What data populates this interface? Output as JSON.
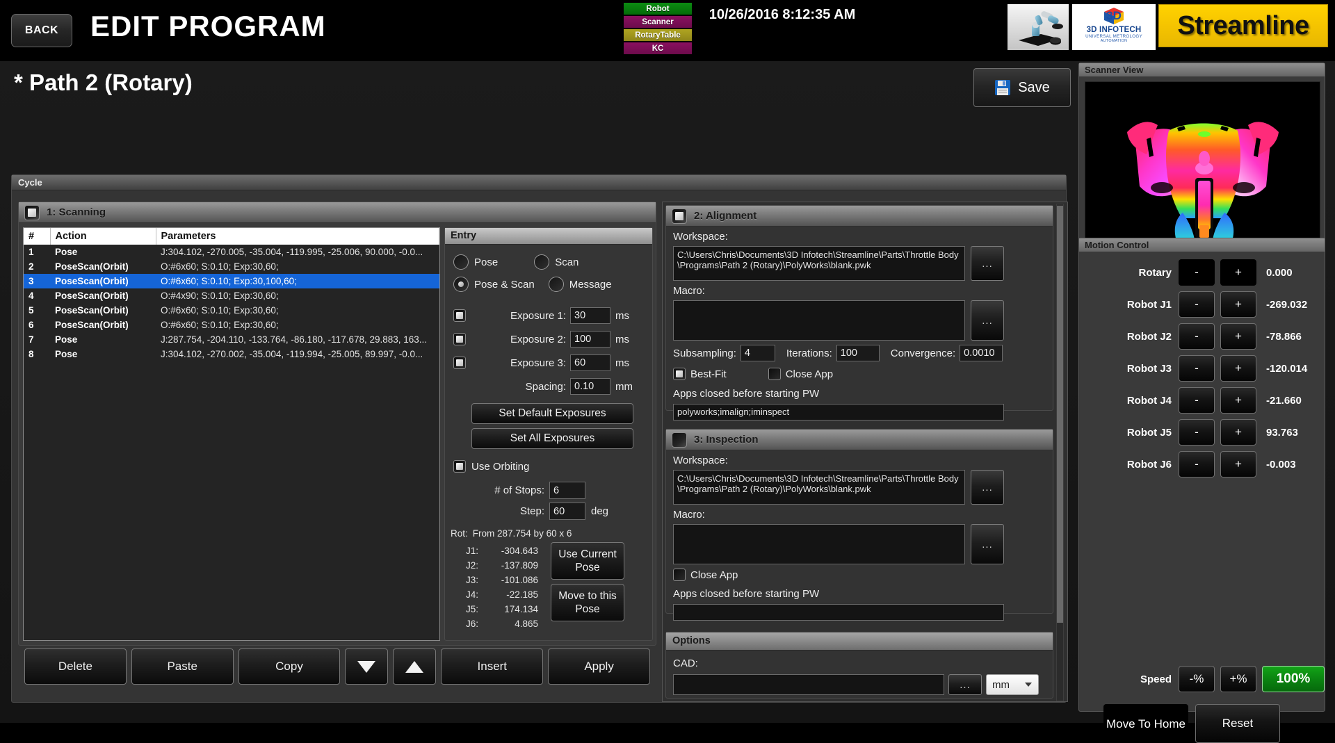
{
  "header": {
    "back_label": "BACK",
    "title": "EDIT PROGRAM",
    "datetime": "10/26/2016  8:12:35 AM",
    "status_chips": [
      {
        "label": "Robot",
        "color": "#0c8c12"
      },
      {
        "label": "Scanner",
        "color": "#8a1060"
      },
      {
        "label": "RotaryTable",
        "color": "#b0a521"
      },
      {
        "label": "KC",
        "color": "#8a1060"
      }
    ],
    "logo_3d_name": "3D INFOTECH",
    "logo_3d_sub": "UNIVERSAL METROLOGY",
    "logo_3d_sub2": "AUTOMATION",
    "logo_3d_cube": "3D",
    "logo_streamline": "Streamline"
  },
  "page": {
    "path_title": "* Path 2 (Rotary)",
    "save_label": "Save",
    "cycle_group_label": "Cycle"
  },
  "scanning": {
    "panel_title": "1: Scanning",
    "checked": true,
    "columns": [
      "#",
      "Action",
      "Parameters"
    ],
    "rows": [
      {
        "n": "1",
        "action": "Pose",
        "params": "J:304.102, -270.005, -35.004, -119.995, -25.006, 90.000, -0.0...",
        "selected": false
      },
      {
        "n": "2",
        "action": "PoseScan(Orbit)",
        "params": "O:#6x60; S:0.10; Exp:30,60;",
        "selected": false
      },
      {
        "n": "3",
        "action": "PoseScan(Orbit)",
        "params": "O:#6x60; S:0.10; Exp:30,100,60;",
        "selected": true
      },
      {
        "n": "4",
        "action": "PoseScan(Orbit)",
        "params": "O:#4x90; S:0.10; Exp:30,60;",
        "selected": false
      },
      {
        "n": "5",
        "action": "PoseScan(Orbit)",
        "params": "O:#6x60; S:0.10; Exp:30,60;",
        "selected": false
      },
      {
        "n": "6",
        "action": "PoseScan(Orbit)",
        "params": "O:#6x60; S:0.10; Exp:30,60;",
        "selected": false
      },
      {
        "n": "7",
        "action": "Pose",
        "params": "J:287.754, -204.110, -133.764, -86.180, -117.678, 29.883, 163...",
        "selected": false
      },
      {
        "n": "8",
        "action": "Pose",
        "params": "J:304.102, -270.002, -35.004, -119.994, -25.005, 89.997, -0.0...",
        "selected": false
      }
    ]
  },
  "action_buttons": [
    {
      "label": "Delete",
      "name": "delete-button"
    },
    {
      "label": "Paste",
      "name": "paste-button"
    },
    {
      "label": "Copy",
      "name": "copy-button"
    },
    {
      "label": "",
      "name": "move-down-button",
      "icon": "triangle-down-icon"
    },
    {
      "label": "",
      "name": "move-up-button",
      "icon": "triangle-up-icon"
    },
    {
      "label": "Insert",
      "name": "insert-button"
    },
    {
      "label": "Apply",
      "name": "apply-button"
    }
  ],
  "entry": {
    "panel_title": "Entry",
    "radios": [
      {
        "label": "Pose",
        "checked": false
      },
      {
        "label": "Scan",
        "checked": false
      },
      {
        "label": "Pose & Scan",
        "checked": true
      },
      {
        "label": "Message",
        "checked": false
      }
    ],
    "exposure1_label": "Exposure 1:",
    "exposure1_value": "30",
    "exposure1_checked": true,
    "exposure2_label": "Exposure 2:",
    "exposure2_value": "100",
    "exposure2_checked": true,
    "exposure3_label": "Exposure 3:",
    "exposure3_value": "60",
    "exposure3_checked": true,
    "ms_unit": "ms",
    "spacing_label": "Spacing:",
    "spacing_value": "0.10",
    "mm_unit": "mm",
    "set_default_exposures": "Set Default Exposures",
    "set_all_exposures": "Set All Exposures",
    "use_orbiting_label": "Use Orbiting",
    "use_orbiting_checked": true,
    "stops_label": "# of Stops:",
    "stops_value": "6",
    "step_label": "Step:",
    "step_value": "60",
    "deg_unit": "deg",
    "rot_label": "Rot:",
    "rot_value": "From 287.754 by 60 x 6",
    "joints": [
      {
        "label": "J1:",
        "value": "-304.643"
      },
      {
        "label": "J2:",
        "value": "-137.809"
      },
      {
        "label": "J3:",
        "value": "-101.086"
      },
      {
        "label": "J4:",
        "value": "-22.185"
      },
      {
        "label": "J5:",
        "value": "174.134"
      },
      {
        "label": "J6:",
        "value": "4.865"
      }
    ],
    "use_current_pose": "Use Current Pose",
    "move_to_this_pose": "Move to this Pose"
  },
  "alignment": {
    "panel_title": "2: Alignment",
    "checked": true,
    "workspace_label": "Workspace:",
    "workspace_value": "C:\\Users\\Chris\\Documents\\3D Infotech\\Streamline\\Parts\\Throttle Body\\Programs\\Path 2 (Rotary)\\PolyWorks\\blank.pwk",
    "macro_label": "Macro:",
    "macro_value": "",
    "browse_label": "...",
    "subsampling_label": "Subsampling:",
    "subsampling_value": "4",
    "iterations_label": "Iterations:",
    "iterations_value": "100",
    "convergence_label": "Convergence:",
    "convergence_value": "0.0010",
    "bestfit_label": "Best-Fit",
    "bestfit_checked": true,
    "closeapp_label": "Close App",
    "closeapp_checked": false,
    "apps_closed_label": "Apps closed before starting PW",
    "apps_closed_value": "polyworks;imalign;iminspect"
  },
  "inspection": {
    "panel_title": "3: Inspection",
    "checked": false,
    "workspace_label": "Workspace:",
    "workspace_value": "C:\\Users\\Chris\\Documents\\3D Infotech\\Streamline\\Parts\\Throttle Body\\Programs\\Path 2 (Rotary)\\PolyWorks\\blank.pwk",
    "macro_label": "Macro:",
    "macro_value": "",
    "browse_label": "...",
    "closeapp_label": "Close App",
    "closeapp_checked": false,
    "apps_closed_label": "Apps closed before starting PW",
    "apps_closed_value": ""
  },
  "options": {
    "panel_title": "Options",
    "cad_label": "CAD:",
    "cad_value": "",
    "browse_label": "...",
    "units_value": "mm"
  },
  "scanner_view": {
    "title": "Scanner View"
  },
  "motion_control": {
    "title": "Motion Control",
    "minus_label": "-",
    "plus_label": "+",
    "axes": [
      {
        "label": "Rotary",
        "value": "0.000"
      },
      {
        "label": "Robot J1",
        "value": "-269.032"
      },
      {
        "label": "Robot J2",
        "value": "-78.866"
      },
      {
        "label": "Robot J3",
        "value": "-120.014"
      },
      {
        "label": "Robot J4",
        "value": "-21.660"
      },
      {
        "label": "Robot J5",
        "value": "93.763"
      },
      {
        "label": "Robot J6",
        "value": "-0.003"
      }
    ],
    "speed_label": "Speed",
    "speed_minus": "-%",
    "speed_plus": "+%",
    "speed_value": "100%",
    "speed_color": "#0a8110",
    "move_home_label": "Move To Home",
    "reset_label": "Reset"
  }
}
